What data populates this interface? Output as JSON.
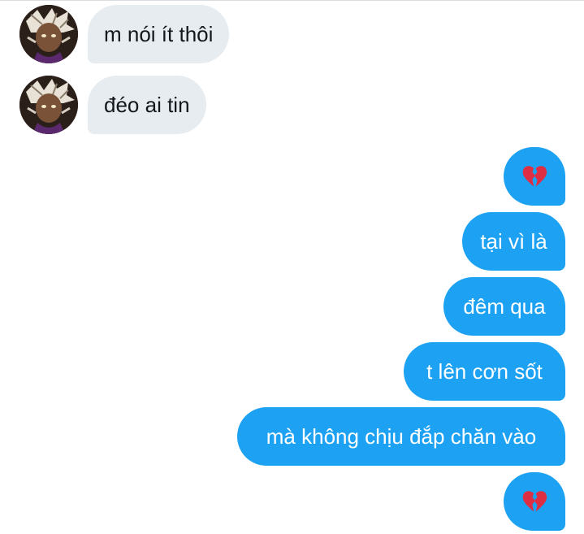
{
  "conversation": {
    "incoming": [
      {
        "text": "m nói ít thôi"
      },
      {
        "text": "đéo ai tin"
      }
    ],
    "outgoing": [
      {
        "type": "emoji",
        "icon": "broken-heart-icon"
      },
      {
        "type": "text",
        "text": "tại vì là"
      },
      {
        "type": "text",
        "text": "đêm qua"
      },
      {
        "type": "text",
        "text": "t lên cơn sốt"
      },
      {
        "type": "text",
        "text": "mà không chịu đắp chăn vào"
      },
      {
        "type": "emoji",
        "icon": "broken-heart-icon"
      }
    ]
  },
  "colors": {
    "incoming_bubble": "#e6ecf0",
    "outgoing_bubble": "#1da1f2",
    "broken_heart": "#dd2e44"
  }
}
